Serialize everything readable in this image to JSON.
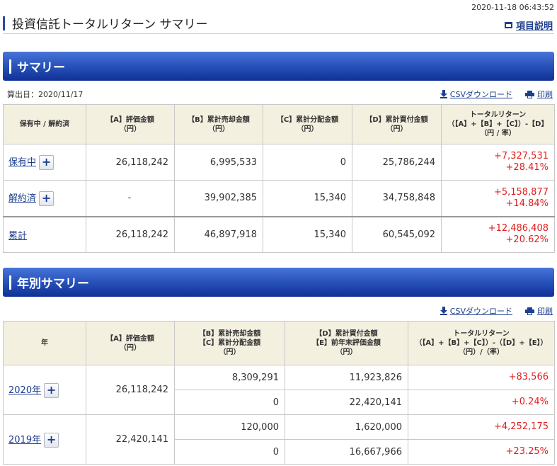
{
  "header": {
    "timestamp": "2020-11-18 06:43:52",
    "title": "投資信託トータルリターン サマリー",
    "help_label": "項目説明"
  },
  "summary": {
    "section_title": "サマリー",
    "calc_date": "算出日：2020/11/17",
    "csv_label": "CSVダウンロード",
    "print_label": "印刷",
    "columns": [
      "保有中 / 解約済",
      "【A】評価金額\n（円）",
      "【B】累計売却金額\n（円）",
      "【C】累計分配金額\n（円）",
      "【D】累計買付金額\n（円）",
      "トータルリターン\n（【A】+【B】+【C】）-【D】\n（円 / 率）"
    ],
    "rows": [
      {
        "label": "保有中",
        "a": "26,118,242",
        "b": "6,995,533",
        "c": "0",
        "d": "25,786,244",
        "tr_yen": "+7,327,531",
        "tr_rate": "+28.41%"
      },
      {
        "label": "解約済",
        "a": "-",
        "b": "39,902,385",
        "c": "15,340",
        "d": "34,758,848",
        "tr_yen": "+5,158,877",
        "tr_rate": "+14.84%"
      },
      {
        "label": "累計",
        "a": "26,118,242",
        "b": "46,897,918",
        "c": "15,340",
        "d": "60,545,092",
        "tr_yen": "+12,486,408",
        "tr_rate": "+20.62%"
      }
    ],
    "plus_symbol": "+"
  },
  "yearly": {
    "section_title": "年別サマリー",
    "csv_label": "CSVダウンロード",
    "print_label": "印刷",
    "columns": [
      "年",
      "【A】評価金額\n（円）",
      "【B】累計売却金額\n【C】累計分配金額\n（円）",
      "【D】累計買付金額\n【E】前年末評価金額\n（円）",
      "トータルリターン\n（【A】+【B】+【C】）-（【D】+【E】）\n（円）/（率）"
    ],
    "rows": [
      {
        "year": "2020年",
        "a": "26,118,242",
        "b": "8,309,291",
        "c": "0",
        "d": "11,923,826",
        "e": "22,420,141",
        "tr_yen": "+83,566",
        "tr_rate": "+0.24%"
      },
      {
        "year": "2019年",
        "a": "22,420,141",
        "b": "120,000",
        "c": "0",
        "d": "1,620,000",
        "e": "16,667,966",
        "tr_yen": "+4,252,175",
        "tr_rate": "+23.25%"
      }
    ]
  },
  "colors": {
    "accent_blue": "#2a55bd",
    "positive_red": "#e01e1e",
    "link_blue": "#1e3f8f",
    "header_beige": "#f4f0e0"
  }
}
